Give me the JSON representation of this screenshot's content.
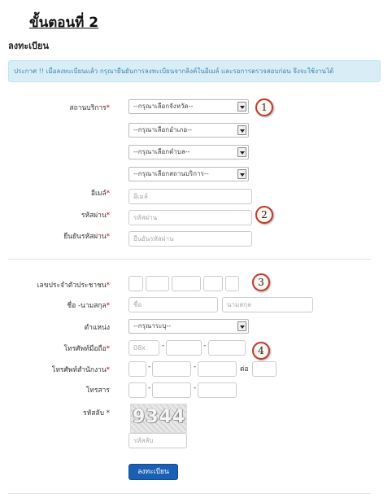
{
  "header": {
    "step_title": "ขั้นตอนที่ 2",
    "section_title": "ลงทะเบียน"
  },
  "notice": "ประกาศ !! เมื่อลงทะเบียนแล้ว กรุณายืนยันการลงทะเบียนจากลิงค์ในอีเมล์ และรอการตรวจสอบก่อน จึงจะใช้งานได้",
  "form": {
    "service_location_label": "สถานบริการ",
    "province_select": "--กรุณาเลือกจังหวัด--",
    "district_select": "--กรุณาเลือกอำเภอ--",
    "subdistrict_select": "--กรุณาเลือกตำบล--",
    "facility_select": "--กรุณาเลือกสถานบริการ--",
    "email_label": "อีเมล์",
    "email_placeholder": "อีเมล์",
    "password_label": "รหัสผ่าน",
    "password_placeholder": "รหัสผ่าน",
    "confirm_password_label": "ยืนยันรหัสผ่าน",
    "confirm_password_placeholder": "ยืนยันรหัสผ่าน",
    "id_card_label": "เลขประจำตัวประชาชน",
    "name_label": "ชื่อ -นามสกุล",
    "first_name_placeholder": "ชื่อ",
    "last_name_placeholder": "นามสกุล",
    "position_label": "ตำแหน่ง",
    "position_select": "--กรุณาระบุ--",
    "mobile_label": "โทรศัพท์มือถือ",
    "mobile_prefix_placeholder": "08x",
    "office_phone_label": "โทรศัพท์สำนักงาน",
    "extension_label": "ต่อ",
    "fax_label": "โทรสาร",
    "captcha_label": "รหัสลับ",
    "captcha_text": "9344",
    "captcha_placeholder": "รหัสลับ",
    "required_mark": "*",
    "dash": "-"
  },
  "annotations": [
    "1",
    "2",
    "3",
    "4"
  ],
  "submit_label": "ลงทะเบียน",
  "colors": {
    "notice_bg": "#d9edf7",
    "notice_text": "#3a87ad",
    "button_bg": "#1a5fb4",
    "required": "#cc0000",
    "annotation_border": "#c0392b"
  }
}
